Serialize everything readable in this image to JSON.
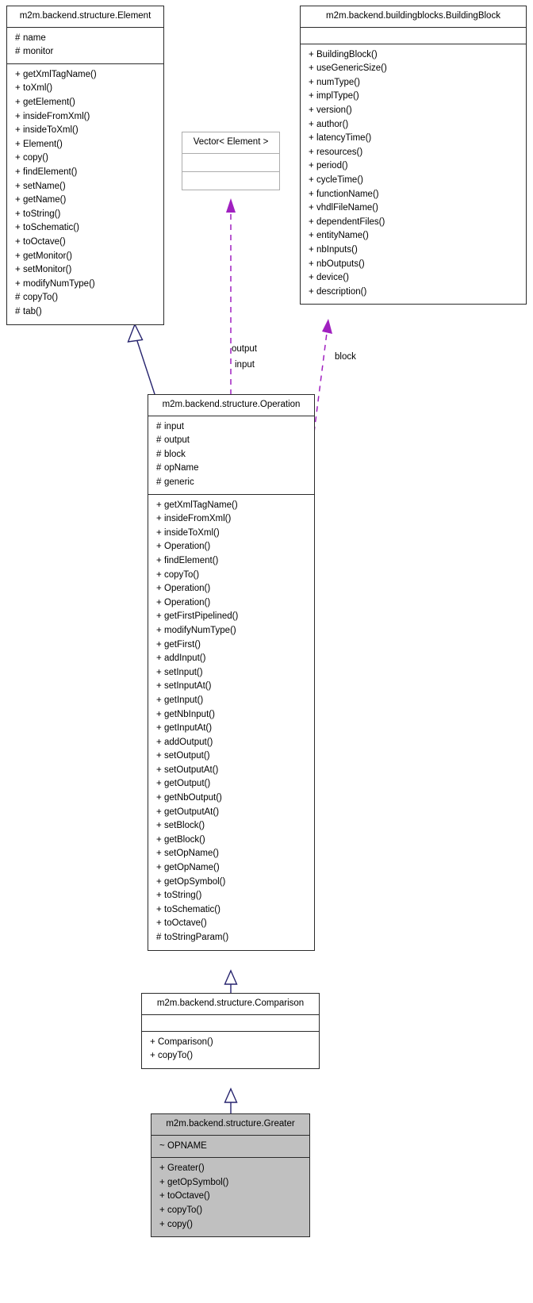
{
  "diagram": {
    "kind": "uml-class-diagram",
    "colors": {
      "inheritance_edge": "#27246e",
      "association_edge": "#a020c0",
      "class_border": "#2b2b2b",
      "ghost_border": "#acacac",
      "highlight_fill": "#c0c0c0",
      "background": "#ffffff"
    }
  },
  "classes": {
    "element": {
      "name": "m2m.backend.structure.Element",
      "attributes": [
        {
          "vis": "#",
          "label": "name"
        },
        {
          "vis": "#",
          "label": "monitor"
        }
      ],
      "operations": [
        {
          "vis": "+",
          "label": "getXmlTagName()"
        },
        {
          "vis": "+",
          "label": "toXml()"
        },
        {
          "vis": "+",
          "label": "getElement()"
        },
        {
          "vis": "+",
          "label": "insideFromXml()"
        },
        {
          "vis": "+",
          "label": "insideToXml()"
        },
        {
          "vis": "+",
          "label": "Element()"
        },
        {
          "vis": "+",
          "label": "copy()"
        },
        {
          "vis": "+",
          "label": "findElement()"
        },
        {
          "vis": "+",
          "label": "setName()"
        },
        {
          "vis": "+",
          "label": "getName()"
        },
        {
          "vis": "+",
          "label": "toString()"
        },
        {
          "vis": "+",
          "label": "toSchematic()"
        },
        {
          "vis": "+",
          "label": "toOctave()"
        },
        {
          "vis": "+",
          "label": "getMonitor()"
        },
        {
          "vis": "+",
          "label": "setMonitor()"
        },
        {
          "vis": "+",
          "label": "modifyNumType()"
        },
        {
          "vis": "#",
          "label": "copyTo()"
        },
        {
          "vis": "#",
          "label": "tab()"
        }
      ]
    },
    "buildingblock": {
      "name": "m2m.backend.buildingblocks.BuildingBlock",
      "attributes": [],
      "operations": [
        {
          "vis": "+",
          "label": "BuildingBlock()"
        },
        {
          "vis": "+",
          "label": "useGenericSize()"
        },
        {
          "vis": "+",
          "label": "numType()"
        },
        {
          "vis": "+",
          "label": "implType()"
        },
        {
          "vis": "+",
          "label": "version()"
        },
        {
          "vis": "+",
          "label": "author()"
        },
        {
          "vis": "+",
          "label": "latencyTime()"
        },
        {
          "vis": "+",
          "label": "resources()"
        },
        {
          "vis": "+",
          "label": "period()"
        },
        {
          "vis": "+",
          "label": "cycleTime()"
        },
        {
          "vis": "+",
          "label": "functionName()"
        },
        {
          "vis": "+",
          "label": "vhdlFileName()"
        },
        {
          "vis": "+",
          "label": "dependentFiles()"
        },
        {
          "vis": "+",
          "label": "entityName()"
        },
        {
          "vis": "+",
          "label": "nbInputs()"
        },
        {
          "vis": "+",
          "label": "nbOutputs()"
        },
        {
          "vis": "+",
          "label": "device()"
        },
        {
          "vis": "+",
          "label": "description()"
        }
      ]
    },
    "vector": {
      "name": "Vector< Element >",
      "attributes": [],
      "operations": []
    },
    "operation": {
      "name": "m2m.backend.structure.Operation",
      "attributes": [
        {
          "vis": "#",
          "label": "input"
        },
        {
          "vis": "#",
          "label": "output"
        },
        {
          "vis": "#",
          "label": "block"
        },
        {
          "vis": "#",
          "label": "opName"
        },
        {
          "vis": "#",
          "label": "generic"
        }
      ],
      "operations": [
        {
          "vis": "+",
          "label": "getXmlTagName()"
        },
        {
          "vis": "+",
          "label": "insideFromXml()"
        },
        {
          "vis": "+",
          "label": "insideToXml()"
        },
        {
          "vis": "+",
          "label": "Operation()"
        },
        {
          "vis": "+",
          "label": "findElement()"
        },
        {
          "vis": "+",
          "label": "copyTo()"
        },
        {
          "vis": "+",
          "label": "Operation()"
        },
        {
          "vis": "+",
          "label": "Operation()"
        },
        {
          "vis": "+",
          "label": "getFirstPipelined()"
        },
        {
          "vis": "+",
          "label": "modifyNumType()"
        },
        {
          "vis": "+",
          "label": "getFirst()"
        },
        {
          "vis": "+",
          "label": "addInput()"
        },
        {
          "vis": "+",
          "label": "setInput()"
        },
        {
          "vis": "+",
          "label": "setInputAt()"
        },
        {
          "vis": "+",
          "label": "getInput()"
        },
        {
          "vis": "+",
          "label": "getNbInput()"
        },
        {
          "vis": "+",
          "label": "getInputAt()"
        },
        {
          "vis": "+",
          "label": "addOutput()"
        },
        {
          "vis": "+",
          "label": "setOutput()"
        },
        {
          "vis": "+",
          "label": "setOutputAt()"
        },
        {
          "vis": "+",
          "label": "getOutput()"
        },
        {
          "vis": "+",
          "label": "getNbOutput()"
        },
        {
          "vis": "+",
          "label": "getOutputAt()"
        },
        {
          "vis": "+",
          "label": "setBlock()"
        },
        {
          "vis": "+",
          "label": "getBlock()"
        },
        {
          "vis": "+",
          "label": "setOpName()"
        },
        {
          "vis": "+",
          "label": "getOpName()"
        },
        {
          "vis": "+",
          "label": "getOpSymbol()"
        },
        {
          "vis": "+",
          "label": "toString()"
        },
        {
          "vis": "+",
          "label": "toSchematic()"
        },
        {
          "vis": "+",
          "label": "toOctave()"
        },
        {
          "vis": "#",
          "label": "toStringParam()"
        }
      ]
    },
    "comparison": {
      "name": "m2m.backend.structure.Comparison",
      "attributes": [],
      "operations": [
        {
          "vis": "+",
          "label": "Comparison()"
        },
        {
          "vis": "+",
          "label": "copyTo()"
        }
      ]
    },
    "greater": {
      "name": "m2m.backend.structure.Greater",
      "attributes": [
        {
          "vis": "~",
          "label": "OPNAME"
        }
      ],
      "operations": [
        {
          "vis": "+",
          "label": "Greater()"
        },
        {
          "vis": "+",
          "label": "getOpSymbol()"
        },
        {
          "vis": "+",
          "label": "toOctave()"
        },
        {
          "vis": "+",
          "label": "copyTo()"
        },
        {
          "vis": "+",
          "label": "copy()"
        }
      ]
    }
  },
  "edge_labels": {
    "output": "output",
    "input": "input",
    "block": "block"
  }
}
